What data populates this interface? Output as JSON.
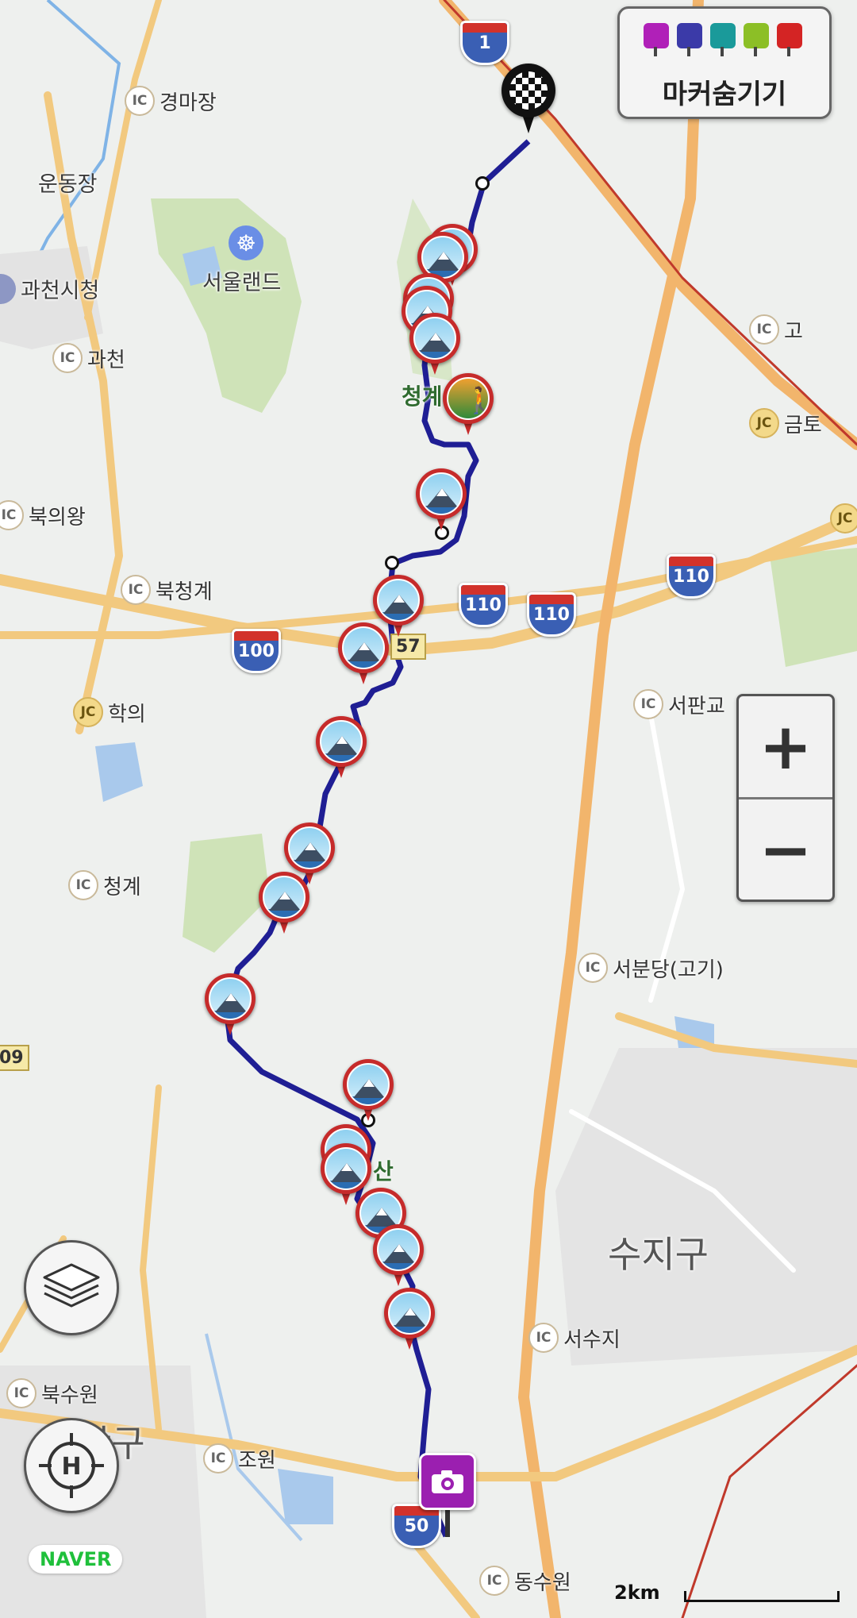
{
  "marker_toggle": {
    "label": "마커숨기기",
    "icons": [
      {
        "name": "camera-marker-icon",
        "color": "#b020b8"
      },
      {
        "name": "video-marker-icon",
        "color": "#3b3aa8"
      },
      {
        "name": "pin-marker-icon",
        "color": "#1a9a9a"
      },
      {
        "name": "note-marker-icon",
        "color": "#8cbf26"
      },
      {
        "name": "flag-marker-icon",
        "color": "#d42424"
      }
    ]
  },
  "zoom": {
    "in_label": "+",
    "out_label": "−"
  },
  "brand": "NAVER",
  "scale_label": "2km",
  "place_labels": {
    "gyeongmajang": "경마장",
    "undongjang": "운동장",
    "seoulland": "서울랜드",
    "gwacheon_cityhall": "과천시청",
    "gwacheon": "과천",
    "cheonggye_top": "청계",
    "bukuiwang": "북의왕",
    "bukcheonggye": "북청계",
    "hakui": "학의",
    "cheonggye_ic": "청계",
    "geumto": "금토",
    "go_partial": "고",
    "seopangyo": "서판교",
    "seobundang": "서분당(고기)",
    "gwanggyosan": "산",
    "sujigu": "수지구",
    "seosuji": "서수지",
    "buksuwon": "북수원",
    "jangangu": "안구",
    "jowon": "조원",
    "dongsuwon": "동수원"
  },
  "ic_badge_text": "IC",
  "jc_badge_text": "JC",
  "highways": {
    "h1": "1",
    "h110a": "110",
    "h110b": "110",
    "h110c": "110",
    "h100": "100",
    "h50": "50"
  },
  "routes": {
    "r57": "57",
    "r09": "09"
  }
}
